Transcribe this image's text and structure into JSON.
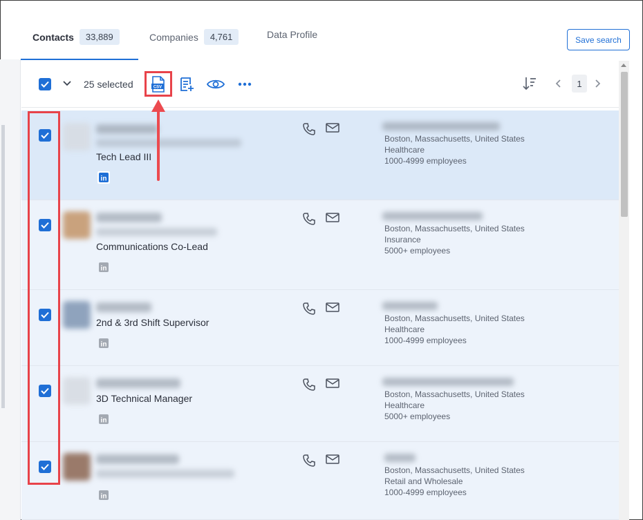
{
  "tabs": [
    {
      "label": "Contacts",
      "count": "33,889",
      "active": true
    },
    {
      "label": "Companies",
      "count": "4,761",
      "active": false
    },
    {
      "label": "Data Profile",
      "count": "",
      "active": false
    }
  ],
  "save_search_label": "Save search",
  "toolbar": {
    "selected_text": "25 selected",
    "page_number": "1",
    "icons": [
      "select-all-checkbox",
      "chevron-down-icon",
      "csv-export-icon",
      "add-to-list-icon",
      "eye-icon",
      "more-icon",
      "sort-icon",
      "chevron-left-icon",
      "chevron-right-icon"
    ]
  },
  "rows": [
    {
      "title": "Tech Lead III",
      "location": "Boston, Massachusetts, United States",
      "industry": "Healthcare",
      "employees": "1000-4999 employees",
      "linkedin_active": true
    },
    {
      "title": "Communications Co-Lead",
      "location": "Boston, Massachusetts, United States",
      "industry": "Insurance",
      "employees": "5000+ employees",
      "linkedin_active": false
    },
    {
      "title": "2nd & 3rd Shift Supervisor",
      "location": "Boston, Massachusetts, United States",
      "industry": "Healthcare",
      "employees": "1000-4999 employees",
      "linkedin_active": false
    },
    {
      "title": "3D Technical Manager",
      "location": "Boston, Massachusetts, United States",
      "industry": "Healthcare",
      "employees": "5000+ employees",
      "linkedin_active": false
    },
    {
      "title": "",
      "location": "Boston, Massachusetts, United States",
      "industry": "Retail and Wholesale",
      "employees": "1000-4999 employees",
      "linkedin_active": false
    }
  ],
  "colors": {
    "accent": "#1f6fd6",
    "highlight": "#e8434a",
    "selected_row": "#dce9f8",
    "row": "#edf3fb"
  }
}
